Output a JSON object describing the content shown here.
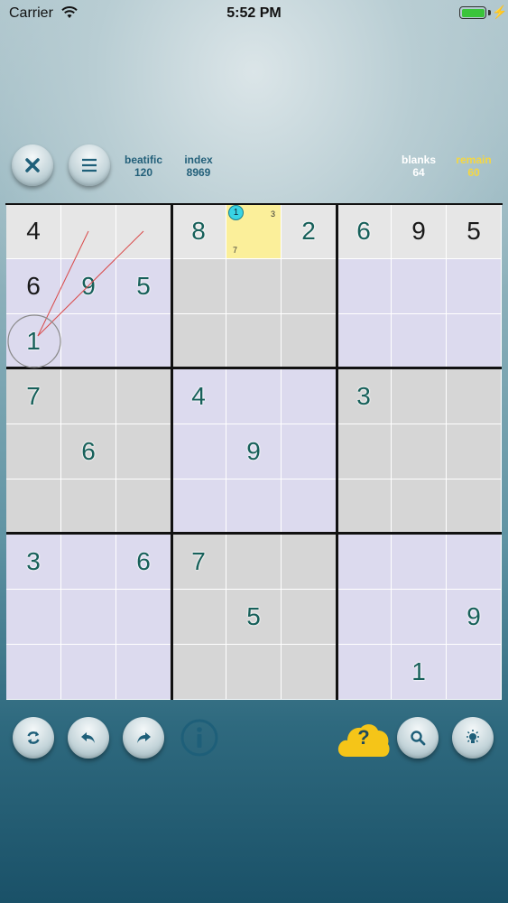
{
  "status_bar": {
    "carrier": "Carrier",
    "time": "5:52 PM",
    "battery_color": "#3ac43a",
    "icons": [
      "wifi-icon",
      "battery-icon",
      "charging-bolt-icon"
    ]
  },
  "header": {
    "close_icon": "close-icon",
    "menu_icon": "menu-icon",
    "difficulty": {
      "label": "beatific",
      "value": "120"
    },
    "index": {
      "label": "index",
      "value": "8969"
    },
    "blanks": {
      "label": "blanks",
      "value": "64"
    },
    "remain": {
      "label": "remain",
      "value": "60"
    }
  },
  "board": {
    "colors": {
      "given": "#1a1a1a",
      "filled": "#17605a",
      "row_highlight": "#e6e6e6",
      "lavender": "#dcdaee",
      "gray": "#d6d6d6",
      "selected": "#fbef9a"
    },
    "highlight_row": 0,
    "selected_cell": {
      "row": 0,
      "col": 4,
      "candidates": [
        "1",
        "3",
        "7"
      ],
      "active_candidate": "1"
    },
    "circled_cell": {
      "row": 2,
      "col": 0
    },
    "rows": [
      [
        {
          "v": "4",
          "t": "given"
        },
        {
          "v": "",
          "t": ""
        },
        {
          "v": "",
          "t": ""
        },
        {
          "v": "8",
          "t": "filled"
        },
        {
          "v": "",
          "t": ""
        },
        {
          "v": "2",
          "t": "filled"
        },
        {
          "v": "6",
          "t": "filled"
        },
        {
          "v": "9",
          "t": "given"
        },
        {
          "v": "5",
          "t": "given"
        }
      ],
      [
        {
          "v": "6",
          "t": "given"
        },
        {
          "v": "9",
          "t": "filled"
        },
        {
          "v": "5",
          "t": "filled"
        },
        {
          "v": "",
          "t": ""
        },
        {
          "v": "",
          "t": ""
        },
        {
          "v": "",
          "t": ""
        },
        {
          "v": "",
          "t": ""
        },
        {
          "v": "",
          "t": ""
        },
        {
          "v": "",
          "t": ""
        }
      ],
      [
        {
          "v": "1",
          "t": "filled"
        },
        {
          "v": "",
          "t": ""
        },
        {
          "v": "",
          "t": ""
        },
        {
          "v": "",
          "t": ""
        },
        {
          "v": "",
          "t": ""
        },
        {
          "v": "",
          "t": ""
        },
        {
          "v": "",
          "t": ""
        },
        {
          "v": "",
          "t": ""
        },
        {
          "v": "",
          "t": ""
        }
      ],
      [
        {
          "v": "7",
          "t": "filled"
        },
        {
          "v": "",
          "t": ""
        },
        {
          "v": "",
          "t": ""
        },
        {
          "v": "4",
          "t": "filled"
        },
        {
          "v": "",
          "t": ""
        },
        {
          "v": "",
          "t": ""
        },
        {
          "v": "3",
          "t": "filled"
        },
        {
          "v": "",
          "t": ""
        },
        {
          "v": "",
          "t": ""
        }
      ],
      [
        {
          "v": "",
          "t": ""
        },
        {
          "v": "6",
          "t": "filled"
        },
        {
          "v": "",
          "t": ""
        },
        {
          "v": "",
          "t": ""
        },
        {
          "v": "9",
          "t": "filled"
        },
        {
          "v": "",
          "t": ""
        },
        {
          "v": "",
          "t": ""
        },
        {
          "v": "",
          "t": ""
        },
        {
          "v": "",
          "t": ""
        }
      ],
      [
        {
          "v": "",
          "t": ""
        },
        {
          "v": "",
          "t": ""
        },
        {
          "v": "",
          "t": ""
        },
        {
          "v": "",
          "t": ""
        },
        {
          "v": "",
          "t": ""
        },
        {
          "v": "",
          "t": ""
        },
        {
          "v": "",
          "t": ""
        },
        {
          "v": "",
          "t": ""
        },
        {
          "v": "",
          "t": ""
        }
      ],
      [
        {
          "v": "3",
          "t": "filled"
        },
        {
          "v": "",
          "t": ""
        },
        {
          "v": "6",
          "t": "filled"
        },
        {
          "v": "7",
          "t": "filled"
        },
        {
          "v": "",
          "t": ""
        },
        {
          "v": "",
          "t": ""
        },
        {
          "v": "",
          "t": ""
        },
        {
          "v": "",
          "t": ""
        },
        {
          "v": "",
          "t": ""
        }
      ],
      [
        {
          "v": "",
          "t": ""
        },
        {
          "v": "",
          "t": ""
        },
        {
          "v": "",
          "t": ""
        },
        {
          "v": "",
          "t": ""
        },
        {
          "v": "5",
          "t": "filled"
        },
        {
          "v": "",
          "t": ""
        },
        {
          "v": "",
          "t": ""
        },
        {
          "v": "",
          "t": ""
        },
        {
          "v": "9",
          "t": "filled"
        }
      ],
      [
        {
          "v": "",
          "t": ""
        },
        {
          "v": "",
          "t": ""
        },
        {
          "v": "",
          "t": ""
        },
        {
          "v": "",
          "t": ""
        },
        {
          "v": "",
          "t": ""
        },
        {
          "v": "",
          "t": ""
        },
        {
          "v": "",
          "t": ""
        },
        {
          "v": "1",
          "t": "filled"
        },
        {
          "v": "",
          " t": ""
        }
      ]
    ]
  },
  "toolbar": {
    "icons": [
      "refresh-icon",
      "undo-icon",
      "redo-icon",
      "info-icon",
      "hint-cloud-icon",
      "search-icon",
      "light-icon"
    ],
    "hint_label": "?",
    "hint_color": "#f5c518"
  }
}
